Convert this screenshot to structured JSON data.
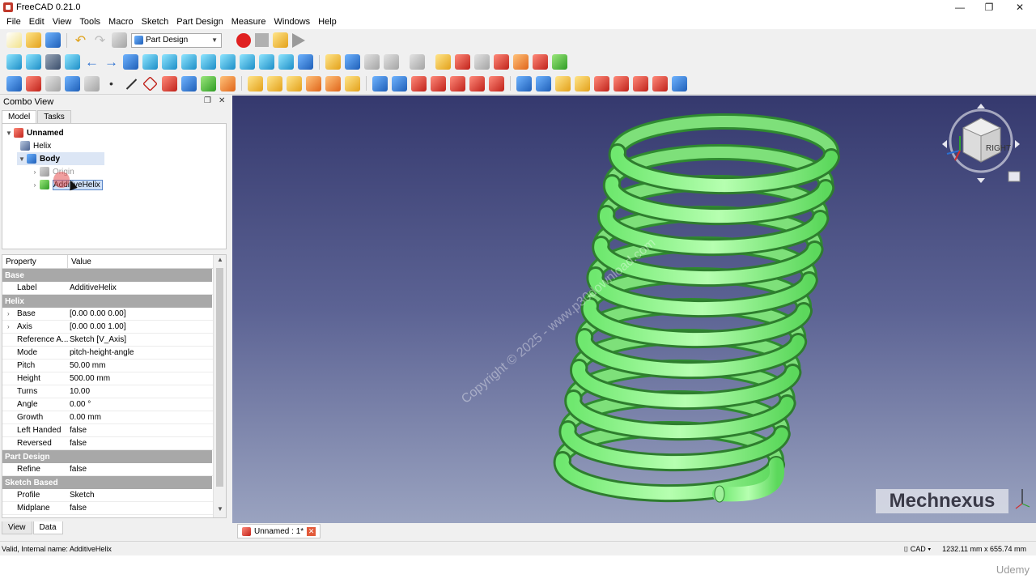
{
  "window": {
    "title": "FreeCAD 0.21.0"
  },
  "menu": [
    "File",
    "Edit",
    "View",
    "Tools",
    "Macro",
    "Sketch",
    "Part Design",
    "Measure",
    "Windows",
    "Help"
  ],
  "workbench": {
    "selected": "Part Design"
  },
  "combo_view": {
    "title": "Combo View",
    "tabs": [
      "Model",
      "Tasks"
    ],
    "tree": {
      "document": "Unnamed",
      "helix": "Helix",
      "body": "Body",
      "origin": "Origin",
      "additive_helix": "AdditiveHelix"
    }
  },
  "properties": {
    "header": {
      "property": "Property",
      "value": "Value"
    },
    "groups": {
      "base": "Base",
      "helix": "Helix",
      "part_design": "Part Design",
      "sketch_based": "Sketch Based"
    },
    "rows": {
      "label": {
        "name": "Label",
        "value": "AdditiveHelix"
      },
      "base": {
        "name": "Base",
        "value": "[0.00 0.00 0.00]"
      },
      "axis": {
        "name": "Axis",
        "value": "[0.00 0.00 1.00]"
      },
      "reference_axis": {
        "name": "Reference A...",
        "value": "Sketch [V_Axis]"
      },
      "mode": {
        "name": "Mode",
        "value": "pitch-height-angle"
      },
      "pitch": {
        "name": "Pitch",
        "value": "50.00 mm"
      },
      "height": {
        "name": "Height",
        "value": "500.00 mm"
      },
      "turns": {
        "name": "Turns",
        "value": "10.00"
      },
      "angle": {
        "name": "Angle",
        "value": "0.00 °"
      },
      "growth": {
        "name": "Growth",
        "value": "0.00 mm"
      },
      "left_handed": {
        "name": "Left Handed",
        "value": "false"
      },
      "reversed": {
        "name": "Reversed",
        "value": "false"
      },
      "refine": {
        "name": "Refine",
        "value": "false"
      },
      "profile": {
        "name": "Profile",
        "value": "Sketch"
      },
      "midplane": {
        "name": "Midplane",
        "value": "false"
      }
    },
    "bottom_tabs": [
      "View",
      "Data"
    ]
  },
  "viewport": {
    "watermark": "Copyright © 2025 - www.p30download.com",
    "logo": "Mechnexus",
    "navcube_face": "RIGHT"
  },
  "document_tab": {
    "label": "Unnamed : 1*"
  },
  "status": {
    "message": "Valid, Internal name: AdditiveHelix",
    "nav_style": "CAD",
    "dimensions": "1232.11 mm x 655.74 mm"
  },
  "overlay": {
    "udemy": "Udemy"
  }
}
